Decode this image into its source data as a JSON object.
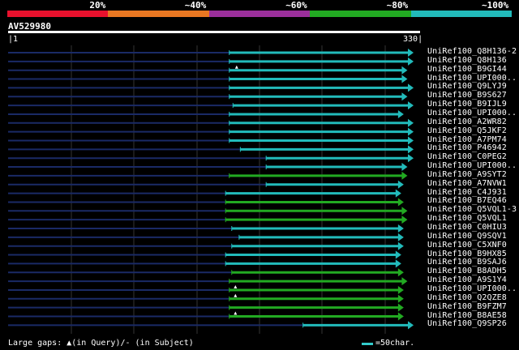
{
  "legend": {
    "colors": [
      "#e8112d",
      "#e87722",
      "#9b2f9b",
      "#22aa22",
      "#22bbbb"
    ],
    "labels": [
      "20%",
      "~40%",
      "~60%",
      "~80%",
      "~100%"
    ]
  },
  "query": {
    "title": "AV529980",
    "start_label": "1",
    "end_label": "330",
    "length": 330
  },
  "hits": [
    {
      "name": "UniRef100_Q8H136-2",
      "start": 180,
      "end": 330,
      "color": "#22bbbb",
      "gaps": []
    },
    {
      "name": "UniRef100_Q8H136",
      "start": 180,
      "end": 330,
      "color": "#22bbbb",
      "gaps": []
    },
    {
      "name": "UniRef100_B9GI44",
      "start": 180,
      "end": 325,
      "color": "#22bbbb",
      "gaps": [
        186
      ]
    },
    {
      "name": "UniRef100_UPI000..",
      "start": 180,
      "end": 325,
      "color": "#22bbbb",
      "gaps": []
    },
    {
      "name": "UniRef100_Q9LYJ9",
      "start": 180,
      "end": 330,
      "color": "#22bbbb",
      "gaps": []
    },
    {
      "name": "UniRef100_B9S627",
      "start": 180,
      "end": 325,
      "color": "#22bbbb",
      "gaps": []
    },
    {
      "name": "UniRef100_B9IJL9",
      "start": 183,
      "end": 330,
      "color": "#22bbbb",
      "gaps": []
    },
    {
      "name": "UniRef100_UPI000..",
      "start": 180,
      "end": 322,
      "color": "#22bbbb",
      "gaps": []
    },
    {
      "name": "UniRef100_A2WR82",
      "start": 180,
      "end": 330,
      "color": "#22bbbb",
      "gaps": []
    },
    {
      "name": "UniRef100_Q5JKF2",
      "start": 180,
      "end": 330,
      "color": "#22bbbb",
      "gaps": []
    },
    {
      "name": "UniRef100_A7PM74",
      "start": 180,
      "end": 330,
      "color": "#22bbbb",
      "gaps": []
    },
    {
      "name": "UniRef100_P46942",
      "start": 189,
      "end": 330,
      "color": "#22bbbb",
      "gaps": []
    },
    {
      "name": "UniRef100_C0PEG2",
      "start": 210,
      "end": 330,
      "color": "#22bbbb",
      "gaps": []
    },
    {
      "name": "UniRef100_UPI000..",
      "start": 210,
      "end": 325,
      "color": "#22bbbb",
      "gaps": []
    },
    {
      "name": "UniRef100_A9SYT2",
      "start": 180,
      "end": 325,
      "color": "#22aa22",
      "gaps": []
    },
    {
      "name": "UniRef100_A7NVW1",
      "start": 210,
      "end": 322,
      "color": "#22bbbb",
      "gaps": []
    },
    {
      "name": "UniRef100_C4J931",
      "start": 177,
      "end": 320,
      "color": "#22bbbb",
      "gaps": []
    },
    {
      "name": "UniRef100_B7EQ46",
      "start": 177,
      "end": 322,
      "color": "#22aa22",
      "gaps": []
    },
    {
      "name": "UniRef100_Q5VQL1-3",
      "start": 177,
      "end": 325,
      "color": "#22aa22",
      "gaps": []
    },
    {
      "name": "UniRef100_Q5VQL1",
      "start": 177,
      "end": 325,
      "color": "#22aa22",
      "gaps": []
    },
    {
      "name": "UniRef100_C0HIU3",
      "start": 182,
      "end": 322,
      "color": "#22bbbb",
      "gaps": []
    },
    {
      "name": "UniRef100_Q9SQV1",
      "start": 188,
      "end": 322,
      "color": "#22bbbb",
      "gaps": []
    },
    {
      "name": "UniRef100_C5XNF0",
      "start": 182,
      "end": 322,
      "color": "#22bbbb",
      "gaps": []
    },
    {
      "name": "UniRef100_B9HX85",
      "start": 177,
      "end": 320,
      "color": "#22bbbb",
      "gaps": []
    },
    {
      "name": "UniRef100_B9SAJ6",
      "start": 177,
      "end": 320,
      "color": "#22bbbb",
      "gaps": []
    },
    {
      "name": "UniRef100_B8ADH5",
      "start": 182,
      "end": 322,
      "color": "#22aa22",
      "gaps": []
    },
    {
      "name": "UniRef100_A9S1Y4",
      "start": 180,
      "end": 325,
      "color": "#22aa22",
      "gaps": []
    },
    {
      "name": "UniRef100_UPI000..",
      "start": 180,
      "end": 322,
      "color": "#22aa22",
      "gaps": [
        185
      ]
    },
    {
      "name": "UniRef100_Q2QZE8",
      "start": 180,
      "end": 322,
      "color": "#22aa22",
      "gaps": [
        185
      ]
    },
    {
      "name": "UniRef100_B9FZM7",
      "start": 180,
      "end": 322,
      "color": "#22aa22",
      "gaps": []
    },
    {
      "name": "UniRef100_B8AE58",
      "start": 180,
      "end": 322,
      "color": "#22aa22",
      "gaps": [
        185
      ]
    },
    {
      "name": "UniRef100_Q9SP26",
      "start": 240,
      "end": 330,
      "color": "#22bbbb",
      "gaps": []
    }
  ],
  "footer": {
    "gaps_text": "Large gaps: ▲(in Query)/- (in Subject)",
    "scale_text": "=50char."
  }
}
